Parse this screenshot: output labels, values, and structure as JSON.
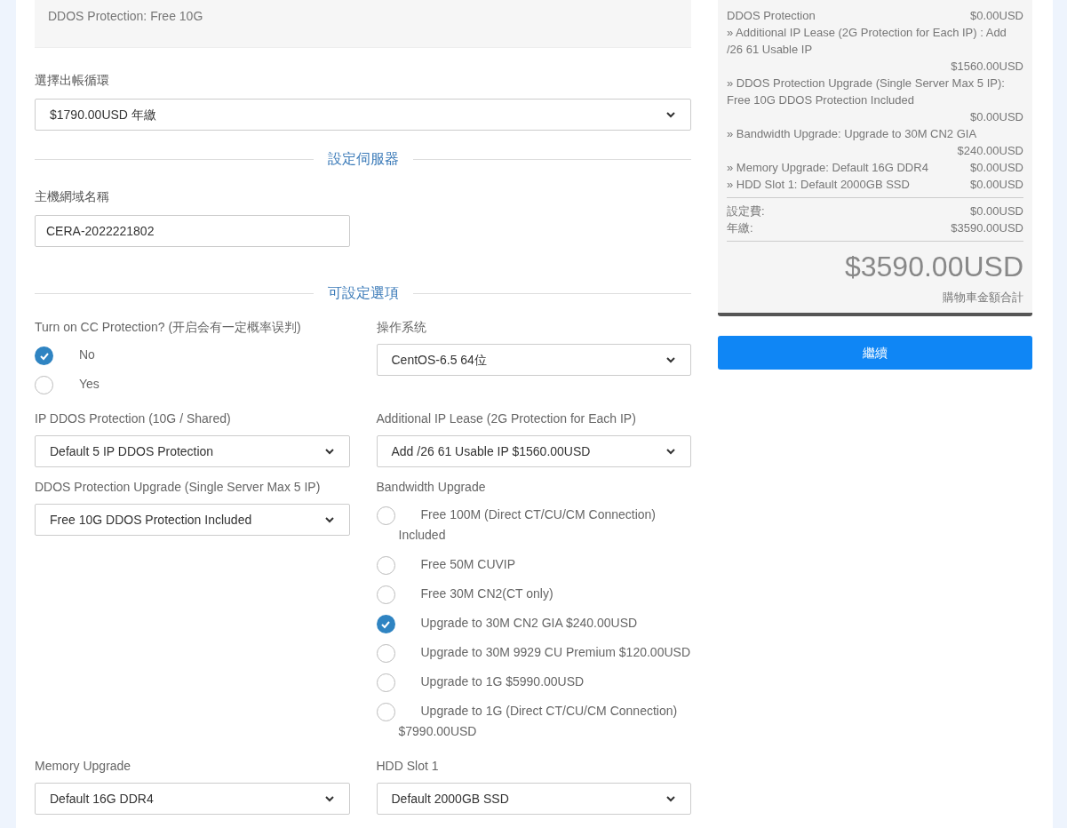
{
  "product_summary": {
    "lines": [
      "DDOS Protection: Free 10G"
    ]
  },
  "billing_cycle": {
    "label": "選擇出帳循環",
    "value": "$1790.00USD 年繳"
  },
  "server_section": {
    "title": "設定伺服器",
    "hostname_label": "主機網域名稱",
    "hostname_value": "CERA-2022221802"
  },
  "options_section": {
    "title": "可設定選項"
  },
  "options": [
    {
      "kind": "radio",
      "label": "Turn on CC Protection? (开启会有一定概率误判)",
      "choices": [
        {
          "label": "No",
          "selected": true
        },
        {
          "label": "Yes",
          "selected": false
        }
      ]
    },
    {
      "kind": "select",
      "label": "操作系统",
      "value": "CentOS-6.5 64位"
    },
    {
      "kind": "select",
      "label": "IP DDOS Protection (10G / Shared)",
      "value": "Default 5 IP DDOS Protection"
    },
    {
      "kind": "select",
      "label": "Additional IP Lease (2G Protection for Each IP)",
      "value": "Add /26 61 Usable IP $1560.00USD"
    },
    {
      "kind": "select",
      "label": "DDOS Protection Upgrade (Single Server Max 5 IP)",
      "value": "Free 10G DDOS Protection Included"
    },
    {
      "kind": "radio",
      "label": "Bandwidth Upgrade",
      "choices": [
        {
          "label": "Free 100M (Direct CT/CU/CM Connection) Included",
          "selected": false
        },
        {
          "label": "Free 50M CUVIP",
          "selected": false
        },
        {
          "label": "Free 30M CN2(CT only)",
          "selected": false
        },
        {
          "label": "Upgrade to 30M CN2 GIA $240.00USD",
          "selected": true
        },
        {
          "label": "Upgrade to 30M 9929 CU Premium $120.00USD",
          "selected": false
        },
        {
          "label": "Upgrade to 1G $5990.00USD",
          "selected": false
        },
        {
          "label": "Upgrade to 1G (Direct CT/CU/CM Connection) $7990.00USD",
          "selected": false
        }
      ]
    },
    {
      "kind": "select",
      "label": "Memory Upgrade",
      "value": "Default 16G DDR4"
    },
    {
      "kind": "select",
      "label": "HDD Slot 1",
      "value": "Default 2000GB SSD"
    }
  ],
  "order_summary": {
    "items": [
      {
        "label": "DDOS Protection",
        "price": "$0.00USD"
      },
      {
        "label": "» Additional IP Lease (2G Protection for Each IP) : Add /26 61 Usable IP",
        "price": "$1560.00USD"
      },
      {
        "label": "» DDOS Protection Upgrade (Single Server Max 5 IP): Free 10G DDOS Protection Included",
        "price": "$0.00USD"
      },
      {
        "label": "» Bandwidth Upgrade: Upgrade to 30M CN2 GIA",
        "price": "$240.00USD"
      },
      {
        "label": "» Memory Upgrade: Default 16G DDR4",
        "price": "$0.00USD"
      },
      {
        "label": "» HDD Slot 1: Default 2000GB SSD",
        "price": "$0.00USD"
      }
    ],
    "fees": [
      {
        "label": "設定費:",
        "price": "$0.00USD"
      },
      {
        "label": "年繳:",
        "price": "$3590.00USD"
      }
    ],
    "total": "$3590.00USD",
    "total_label": "購物車金額合計"
  },
  "continue_button": "繼續"
}
